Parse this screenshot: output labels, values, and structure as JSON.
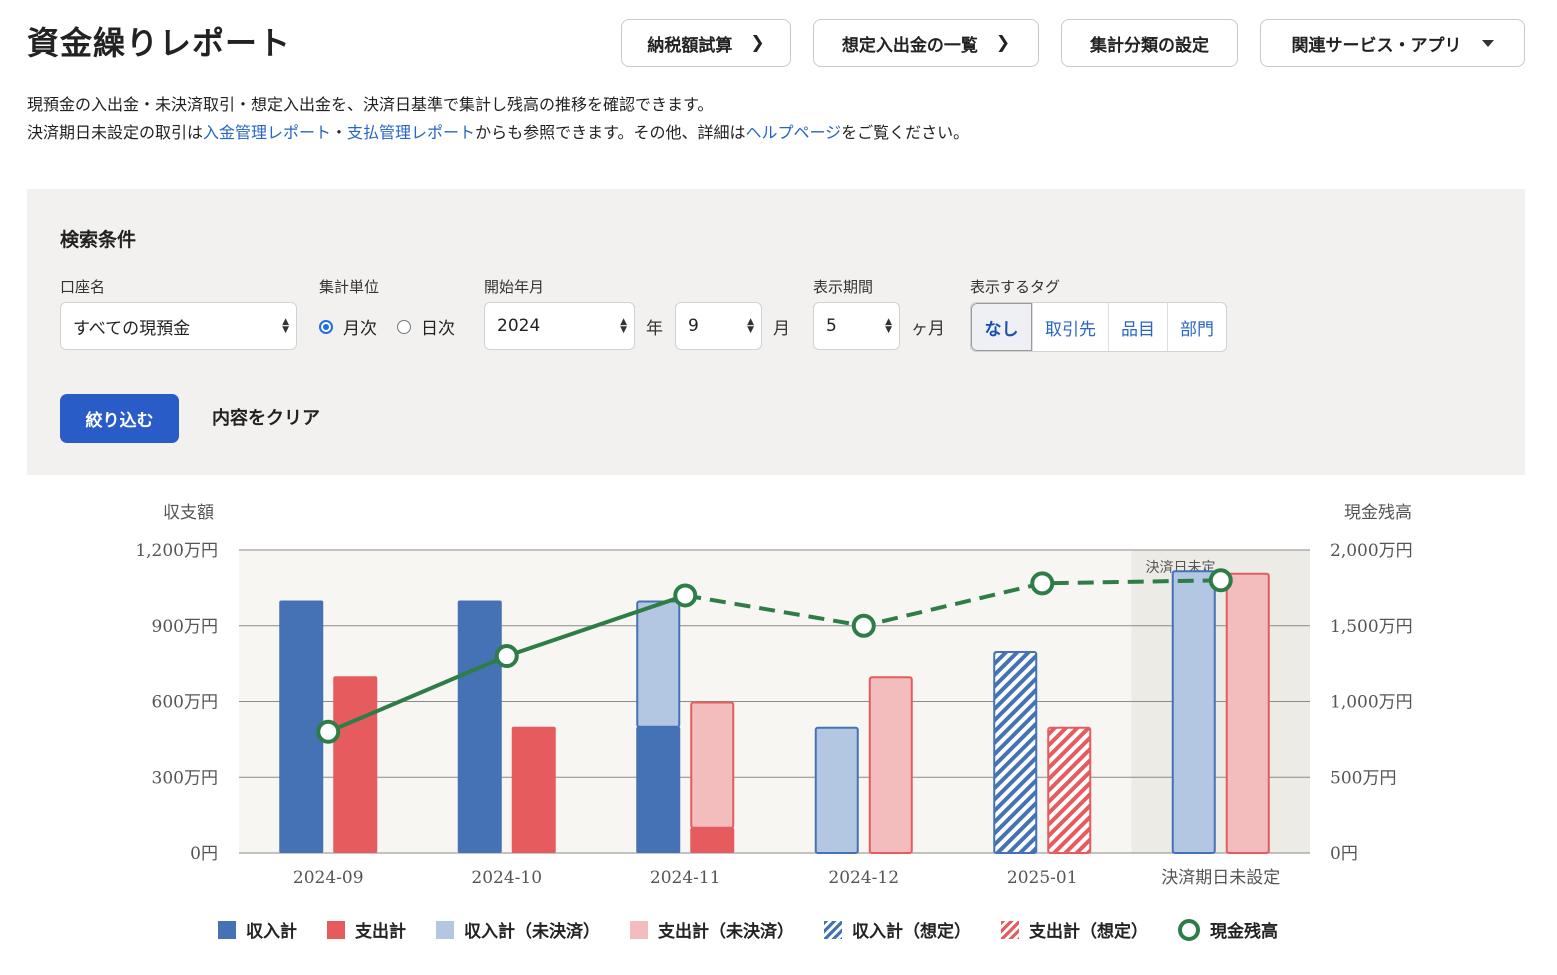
{
  "header": {
    "title": "資金繰りレポート",
    "buttons": [
      {
        "label": "納税額試算"
      },
      {
        "label": "想定入出金の一覧"
      },
      {
        "label": "集計分類の設定"
      },
      {
        "label": "関連サービス・アプリ"
      }
    ]
  },
  "description": {
    "line1": "現預金の入出金・未決済取引・想定入出金を、決済日基準で集計し残高の推移を確認できます。",
    "line2_a": "決済期日未設定の取引は",
    "link_income": "入金管理レポート",
    "line2_sep": "・",
    "link_payment": "支払管理レポート",
    "line2_b": "からも参照できます。その他、詳細は",
    "link_help": "ヘルプページ",
    "line2_c": "をご覧ください。"
  },
  "search": {
    "title": "検索条件",
    "account": {
      "label": "口座名",
      "value": "すべての現預金"
    },
    "unit": {
      "label": "集計単位",
      "options": [
        {
          "label": "月次",
          "checked": true
        },
        {
          "label": "日次",
          "checked": false
        }
      ]
    },
    "start": {
      "label": "開始年月",
      "year": "2024",
      "year_unit": "年",
      "month": "9",
      "month_unit": "月"
    },
    "period": {
      "label": "表示期間",
      "value": "5",
      "unit": "ヶ月"
    },
    "tags": {
      "label": "表示するタグ",
      "items": [
        "なし",
        "取引先",
        "品目",
        "部門"
      ]
    },
    "submit_label": "絞り込む",
    "clear_label": "内容をクリア"
  },
  "chart_data": {
    "type": "bar",
    "left_axis_title": "収支額",
    "right_axis_title": "現金残高",
    "categories": [
      "2024-09",
      "2024-10",
      "2024-11",
      "2024-12",
      "2025-01",
      "決済期日未設定"
    ],
    "left_ticks": [
      "0円",
      "300万円",
      "600万円",
      "900万円",
      "1,200万円"
    ],
    "right_ticks": [
      "0円",
      "500万円",
      "1,000万円",
      "1,500万円",
      "2,000万円"
    ],
    "ylim_left": [
      0,
      1200
    ],
    "ylim_right": [
      0,
      2000
    ],
    "unsettled_annotation": "決済日未定",
    "series": [
      {
        "name": "収入計",
        "values": [
          1000,
          1000,
          500,
          0,
          0,
          0
        ]
      },
      {
        "name": "支出計",
        "values": [
          700,
          500,
          100,
          0,
          0,
          0
        ]
      },
      {
        "name": "収入計（未決済）",
        "values": [
          0,
          0,
          500,
          500,
          0,
          1120
        ]
      },
      {
        "name": "支出計（未決済）",
        "values": [
          0,
          0,
          500,
          700,
          0,
          1110
        ]
      },
      {
        "name": "収入計（想定）",
        "values": [
          0,
          0,
          0,
          0,
          800,
          0
        ]
      },
      {
        "name": "支出計（想定）",
        "values": [
          0,
          0,
          0,
          0,
          500,
          0
        ]
      },
      {
        "name": "現金残高",
        "values": [
          800,
          1300,
          1700,
          1500,
          1780,
          1800
        ]
      }
    ],
    "colors": {
      "income": "#4472b4",
      "expense": "#e55b5e",
      "income_unsettled": "#b3c7e2",
      "expense_unsettled": "#f3bcbd",
      "balance": "#2e7d46",
      "unsettled_bg": "#ecebe6",
      "plot_bg": "#f7f6f3"
    }
  }
}
